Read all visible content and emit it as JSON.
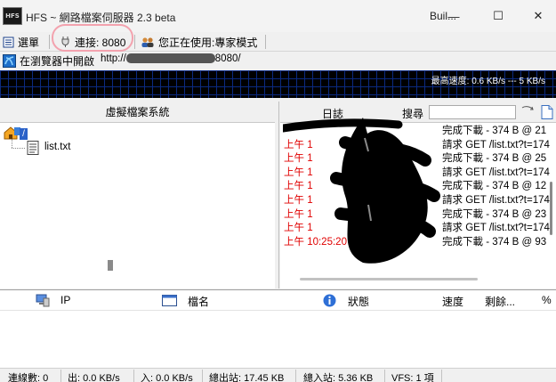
{
  "window": {
    "app_icon_text": "HFS",
    "title": "HFS ~ 網路檔案伺服器 2.3 beta",
    "build_label": "Buil...",
    "minimize_glyph": "—",
    "maximize_glyph": "☐",
    "close_glyph": "✕"
  },
  "toolbar": {
    "menu_label": "選單",
    "port_label": "連接: 8080",
    "mode_label": "您正在使用:專家模式",
    "open_browser_label": "在瀏覽器中開啟",
    "url_prefix": "http://",
    "url_suffix": "8080/"
  },
  "graph": {
    "speed_label": "最高速度: 0.6 KB/s --- 5 KB/s"
  },
  "vfs": {
    "header": "虛擬檔案系統",
    "root_label": "/",
    "files": [
      "list.txt"
    ]
  },
  "log": {
    "header": "日誌",
    "search_label": "搜尋",
    "search_value": "",
    "lines": [
      {
        "time": "",
        "text": "完成下載 - 374 B @ 21"
      },
      {
        "time": "上午 1",
        "text": "請求 GET /list.txt?t=174"
      },
      {
        "time": "上午 1",
        "text": "完成下載 - 374 B @ 25"
      },
      {
        "time": "上午 1",
        "text": "請求 GET /list.txt?t=174"
      },
      {
        "time": "上午 1",
        "text": "完成下載 - 374 B @ 12"
      },
      {
        "time": "上午 1",
        "text": "請求 GET /list.txt?t=174"
      },
      {
        "time": "上午 1",
        "text": "完成下載 - 374 B @ 23"
      },
      {
        "time": "上午 1",
        "text": "請求 GET /list.txt?t=174"
      },
      {
        "time": "上午 10:25:20",
        "text": "完成下載 - 374 B @ 93"
      }
    ],
    "time_color": "#e00000"
  },
  "connections": {
    "columns": {
      "ip": "IP",
      "filename": "檔名",
      "status": "狀態",
      "speed": "速度",
      "remaining": "剩餘...",
      "percent": "%"
    }
  },
  "status": {
    "connections": "連線數: 0",
    "out": "出: 0.0 KB/s",
    "in": "入: 0.0 KB/s",
    "total_out": "總出站: 17.45 KB",
    "total_in": "總入站: 5.36 KB",
    "vfs": "VFS: 1 項"
  },
  "colors": {
    "highlight": "#f3a2ae",
    "graph_bg": "#000000",
    "graph_grid": "#0b2a80"
  }
}
